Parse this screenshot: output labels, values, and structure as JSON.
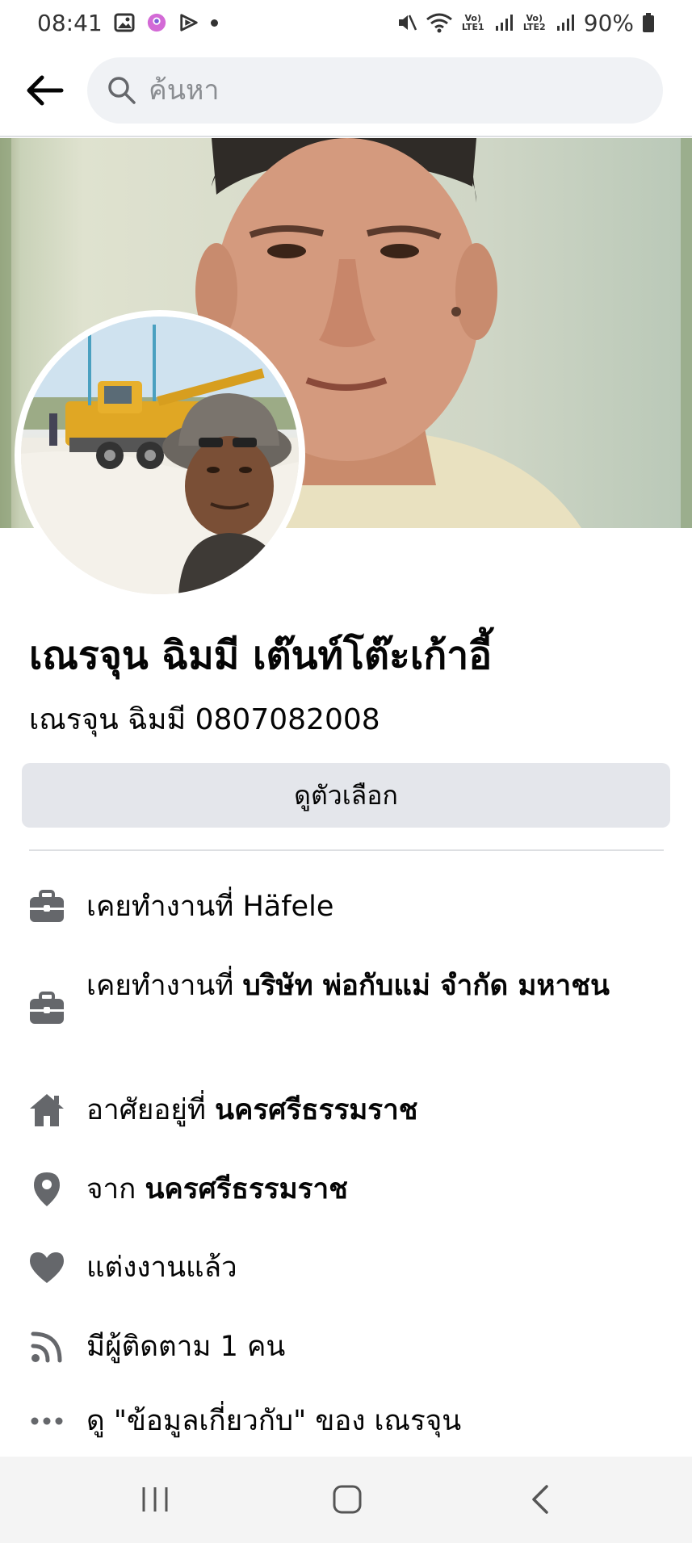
{
  "status_bar": {
    "time": "08:41",
    "battery": "90%",
    "sim1_label": "Vo) LTE1",
    "sim2_label": "Vo) LTE2"
  },
  "search": {
    "placeholder": "ค้นหา"
  },
  "profile": {
    "name": "เณรจุน ฉิมมี เต๊นท์โต๊ะเก้าอี้",
    "alternate_name": "เณรจุน  ฉิมมี 0807082008",
    "options_button": "ดูตัวเลือก"
  },
  "details": [
    {
      "icon": "briefcase-icon",
      "prefix": "เคยทำงานที่ Häfele",
      "bold": ""
    },
    {
      "icon": "briefcase-icon",
      "prefix": "เคยทำงานที่ ",
      "bold": "บริษัท พ่อกับแม่ จำกัด มหาชน"
    },
    {
      "icon": "home-icon",
      "prefix": "อาศัยอยู่ที่ ",
      "bold": "นครศรีธรรมราช"
    },
    {
      "icon": "location-pin-icon",
      "prefix": "จาก ",
      "bold": "นครศรีธรรมราช"
    },
    {
      "icon": "heart-icon",
      "prefix": "แต่งงานแล้ว",
      "bold": ""
    },
    {
      "icon": "rss-icon",
      "prefix": "มีผู้ติดตาม 1 คน",
      "bold": ""
    },
    {
      "icon": "more-icon",
      "prefix": "ดู \"ข้อมูลเกี่ยวกับ\" ของ เณรจุน",
      "bold": ""
    }
  ],
  "colors": {
    "icon_gray": "#65676b",
    "button_bg": "#e4e6eb",
    "search_bg": "#f0f2f5"
  }
}
